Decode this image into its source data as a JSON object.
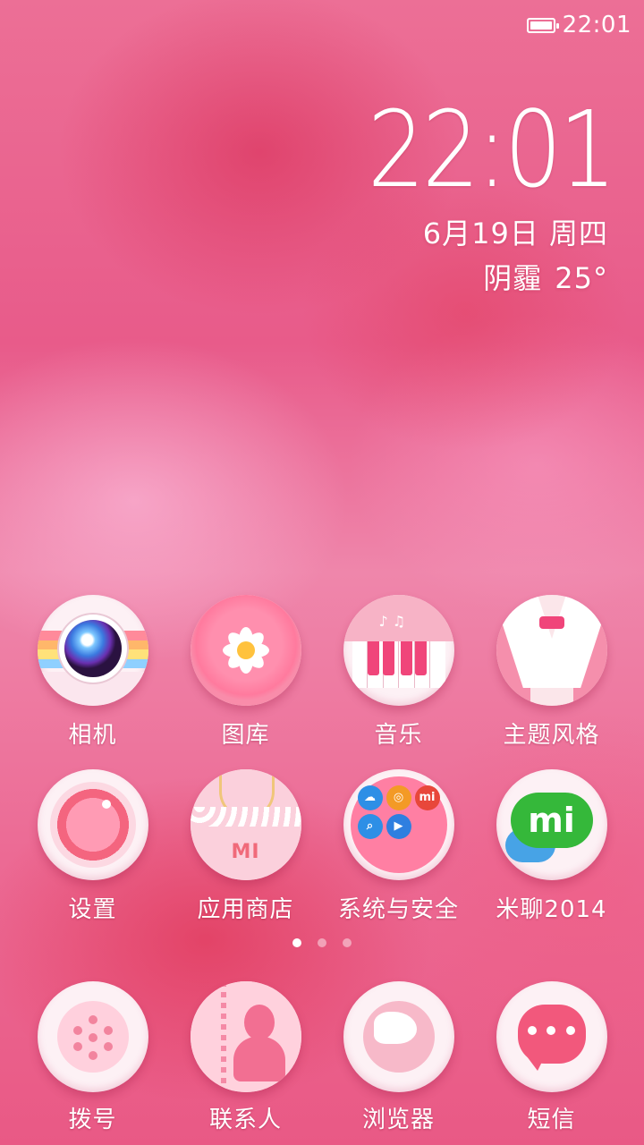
{
  "status_bar": {
    "time": "22:01",
    "battery_level": 1.0
  },
  "clock_widget": {
    "time": "22:01",
    "date": "6月19日 周四",
    "weather": "阴霾",
    "temperature": "25°"
  },
  "home_page_1": {
    "apps": [
      {
        "label": "相机",
        "icon": "camera-icon"
      },
      {
        "label": "图库",
        "icon": "gallery-flower-icon"
      },
      {
        "label": "音乐",
        "icon": "piano-icon"
      },
      {
        "label": "主题风格",
        "icon": "theme-suit-icon"
      },
      {
        "label": "设置",
        "icon": "settings-dial-icon"
      },
      {
        "label": "应用商店",
        "icon": "shopping-bag-icon"
      },
      {
        "label": "系统与安全",
        "icon": "folder-icon"
      },
      {
        "label": "米聊2014",
        "icon": "mi-chat-icon"
      }
    ]
  },
  "page_indicator": {
    "pages": 3,
    "current": 1
  },
  "dock": {
    "apps": [
      {
        "label": "拨号",
        "icon": "dialpad-icon"
      },
      {
        "label": "联系人",
        "icon": "contacts-icon"
      },
      {
        "label": "浏览器",
        "icon": "globe-icon"
      },
      {
        "label": "短信",
        "icon": "message-icon"
      }
    ]
  },
  "colors": {
    "wallpaper": "#e95985",
    "accent": "#f0457a",
    "text": "#ffffff"
  }
}
